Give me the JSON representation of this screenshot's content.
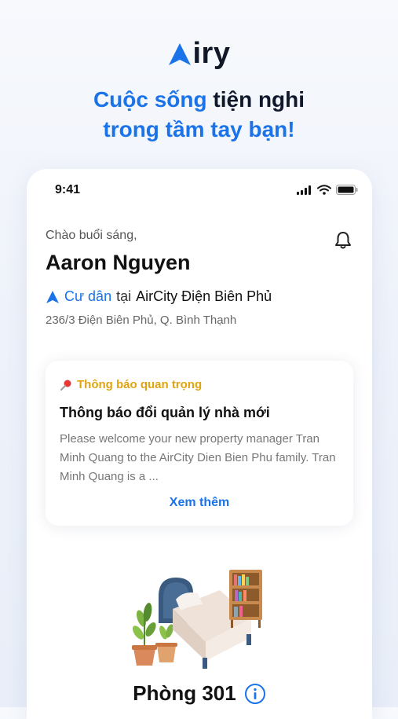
{
  "brand": {
    "logo_text": "iry"
  },
  "headline": {
    "part1_blue": "Cuộc sống",
    "part1_dark": "tiện nghi",
    "part2": "trong tầm tay bạn!"
  },
  "status_bar": {
    "time": "9:41"
  },
  "home": {
    "greeting": "Chào buổi sáng,",
    "user_name": "Aaron Nguyen",
    "role": "Cư dân",
    "role_connector": "tại",
    "building": "AirCity Điện Biên Phủ",
    "address": "236/3 Điện Biên Phủ, Q. Bình Thạnh"
  },
  "notice": {
    "label": "Thông báo quan trọng",
    "title": "Thông báo đổi quản lý nhà mới",
    "body": "Please welcome your new property manager Tran Minh Quang to the AirCity Dien Bien Phu family. Tran Minh Quang is a ...",
    "more": "Xem thêm"
  },
  "room": {
    "title": "Phòng 301"
  },
  "icons": [
    "airy-logo-icon",
    "signal-icon",
    "wifi-icon",
    "battery-icon",
    "bell-icon",
    "location-arrow-icon",
    "pin-icon",
    "info-icon"
  ],
  "colors": {
    "accent": "#1a73e8",
    "warning": "#e0a411",
    "text": "#111111"
  }
}
